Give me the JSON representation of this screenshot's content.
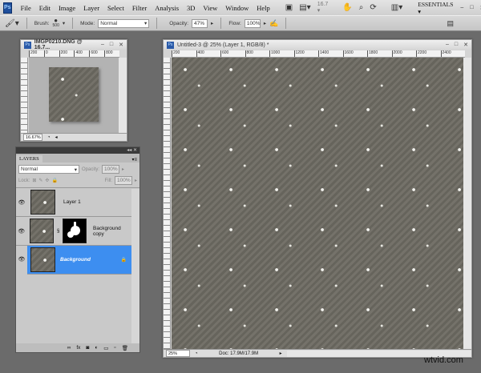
{
  "menubar": {
    "logo": "Ps",
    "items": [
      "File",
      "Edit",
      "Image",
      "Layer",
      "Select",
      "Filter",
      "Analysis",
      "3D",
      "View",
      "Window",
      "Help"
    ],
    "zoom": "16.7",
    "workspace": "ESSENTIALS"
  },
  "options": {
    "brush_label": "Brush:",
    "brush_size": "500",
    "mode_label": "Mode:",
    "mode_value": "Normal",
    "opacity_label": "Opacity:",
    "opacity_value": "47%",
    "flow_label": "Flow:",
    "flow_value": "100%"
  },
  "small_doc": {
    "title": "IMGP0210.DNG @ 16.7...",
    "ruler": [
      "200",
      "0",
      "200",
      "400",
      "600",
      "800"
    ],
    "zoom": "16.67%"
  },
  "main_doc": {
    "title": "Untitled-3 @ 25% (Layer 1, RGB/8) *",
    "ruler": [
      "200",
      "400",
      "600",
      "800",
      "1000",
      "1200",
      "1400",
      "1600",
      "1800",
      "2000",
      "2200",
      "2400"
    ],
    "zoom": "25%",
    "doc_size": "Doc: 17.9M/17.9M"
  },
  "layers": {
    "tab": "LAYERS",
    "blend": "Normal",
    "opacity_label": "Opacity:",
    "opacity": "100%",
    "lock_label": "Lock:",
    "fill_label": "Fill:",
    "fill": "100%",
    "items": [
      {
        "name": "Layer 1"
      },
      {
        "name": "Background copy"
      },
      {
        "name": "Background"
      }
    ]
  },
  "watermark": "wtvid.com"
}
